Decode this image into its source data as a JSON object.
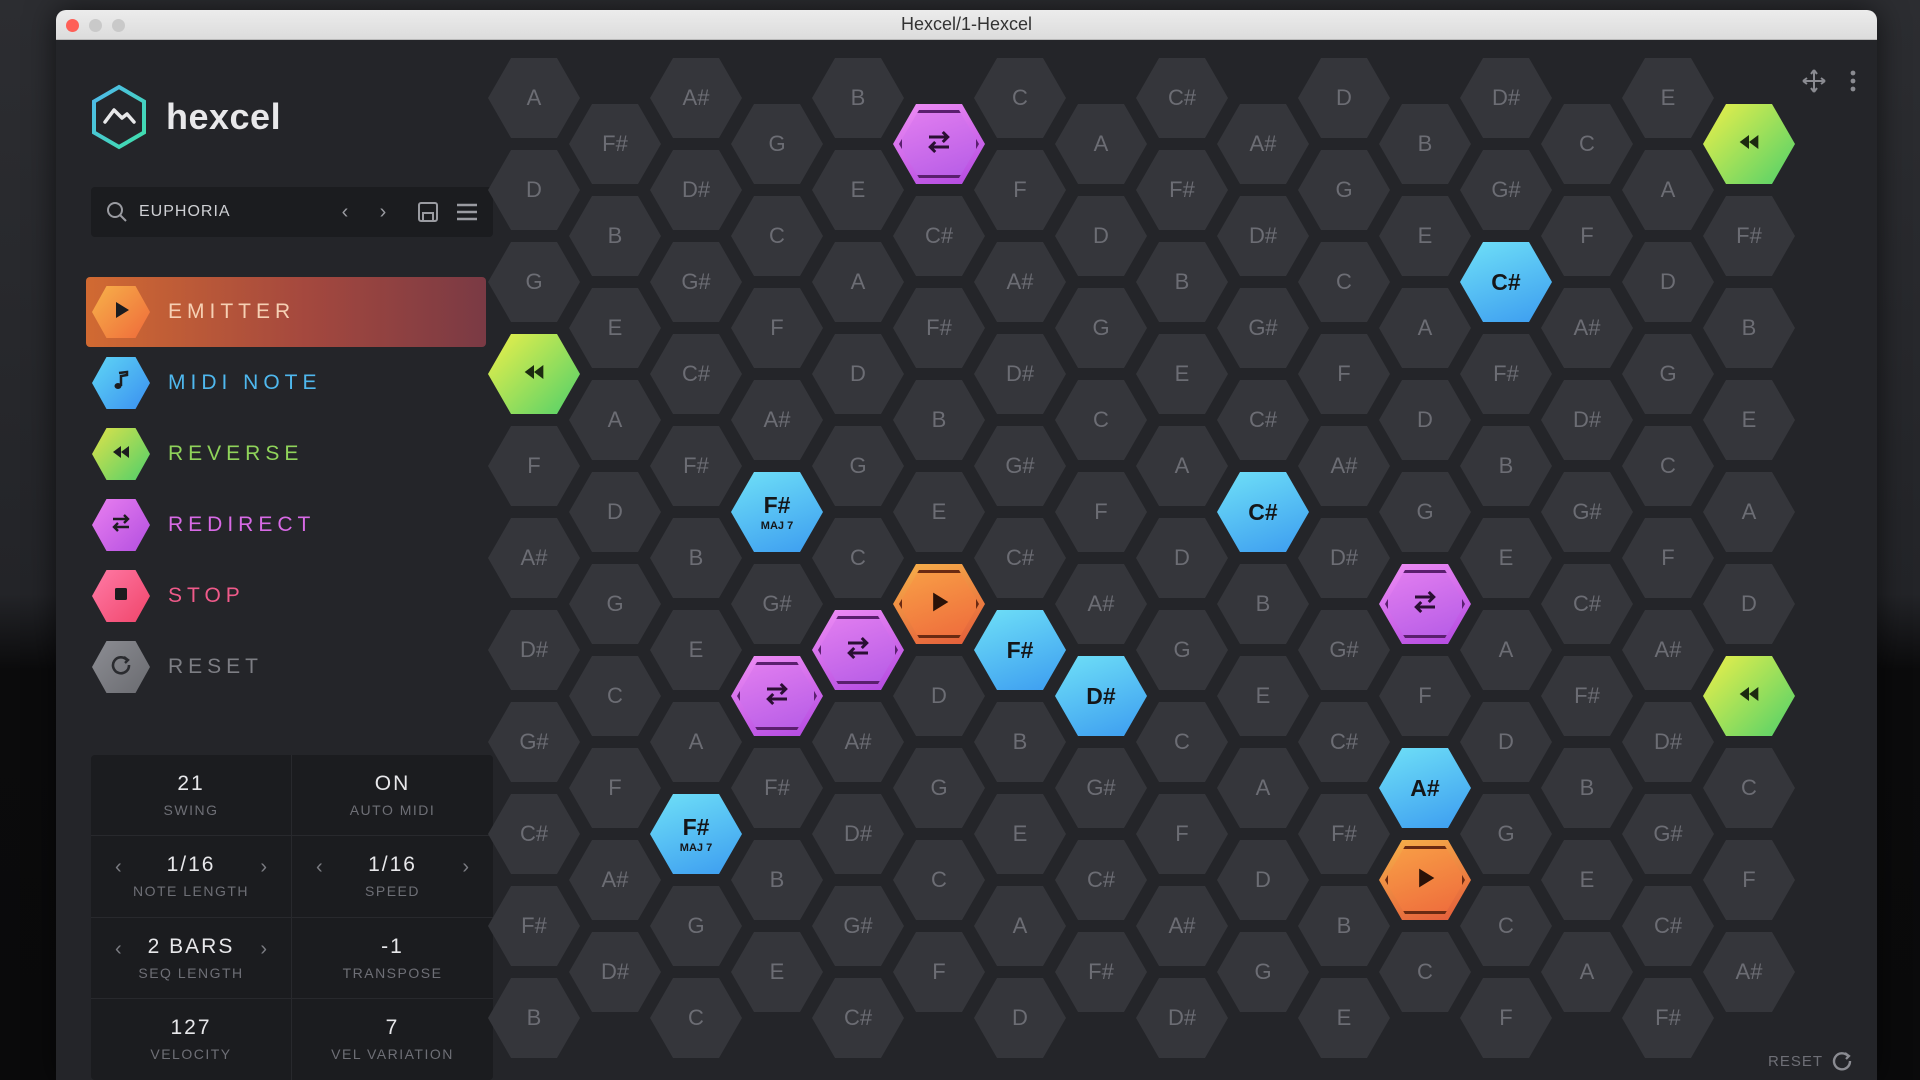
{
  "window": {
    "title": "Hexcel/1-Hexcel"
  },
  "brand": {
    "name": "hexcel",
    "logo_icon": "hexcel-logo-icon",
    "accent": "#3fd1c4"
  },
  "preset": {
    "name": "EUPHORIA",
    "icons": [
      "search-icon",
      "chevron-left-icon",
      "chevron-right-icon",
      "save-icon",
      "menu-icon"
    ]
  },
  "tools": [
    {
      "id": "emitter",
      "label": "EMITTER",
      "color": "#f08a3a",
      "icon": "play-icon",
      "active": true
    },
    {
      "id": "midi-note",
      "label": "MIDI NOTE",
      "color": "#4fb8ee",
      "icon": "music-note-icon",
      "active": false
    },
    {
      "id": "reverse",
      "label": "REVERSE",
      "color": "#8fd35a",
      "icon": "rewind-icon",
      "active": false
    },
    {
      "id": "redirect",
      "label": "REDIRECT",
      "color": "#d86ae6",
      "icon": "redirect-arrows-icon",
      "active": false
    },
    {
      "id": "stop",
      "label": "STOP",
      "color": "#f05a8a",
      "icon": "stop-icon",
      "active": false
    },
    {
      "id": "reset",
      "label": "RESET",
      "color": "#7d7e84",
      "icon": "reset-icon",
      "active": false
    }
  ],
  "params": [
    {
      "id": "swing",
      "value": "21",
      "label": "SWING",
      "arrows": false
    },
    {
      "id": "auto-midi",
      "value": "ON",
      "label": "AUTO MIDI",
      "arrows": false
    },
    {
      "id": "note-length",
      "value": "1/16",
      "label": "NOTE LENGTH",
      "arrows": true
    },
    {
      "id": "speed",
      "value": "1/16",
      "label": "SPEED",
      "arrows": true
    },
    {
      "id": "seq-length",
      "value": "2 BARS",
      "label": "SEQ LENGTH",
      "arrows": true
    },
    {
      "id": "transpose",
      "value": "-1",
      "label": "TRANSPOSE",
      "arrows": false
    },
    {
      "id": "velocity",
      "value": "127",
      "label": "VELOCITY",
      "arrows": false
    },
    {
      "id": "vel-variation",
      "value": "7",
      "label": "VEL VARIATION",
      "arrows": false
    }
  ],
  "grid": {
    "columns": [
      [
        "A",
        "D",
        "G",
        "REV",
        "F",
        "A#",
        "D#",
        "G#",
        "C#",
        "F#",
        "B"
      ],
      [
        "F#",
        "B",
        "E",
        "A",
        "D",
        "G",
        "C",
        "F",
        "A#",
        "D#"
      ],
      [
        "A#",
        "D#",
        "G#",
        "C#",
        "F#",
        "B",
        "E",
        "A",
        "D",
        "G",
        "C"
      ],
      [
        "G",
        "C",
        "F",
        "A#",
        "D#",
        "G#",
        "RED",
        "F#",
        "B",
        "E"
      ],
      [
        "B",
        "E",
        "A",
        "D",
        "G",
        "C",
        "RED",
        "A#",
        "D#",
        "G#",
        "C#"
      ],
      [
        "RED",
        "C#",
        "F#",
        "B",
        "E",
        "EMIT",
        "D",
        "G",
        "C",
        "F"
      ],
      [
        "C",
        "F",
        "A#",
        "D#",
        "G#",
        "C#",
        "F#",
        "B",
        "E",
        "A",
        "D"
      ],
      [
        "A",
        "D",
        "G",
        "C",
        "F",
        "A#",
        "D#",
        "G#",
        "C#",
        "F#"
      ],
      [
        "C#",
        "F#",
        "B",
        "E",
        "A",
        "D",
        "G",
        "C",
        "F",
        "A#",
        "D#"
      ],
      [
        "A#",
        "D#",
        "G#",
        "C#",
        "F#",
        "B",
        "E",
        "A",
        "D",
        "G"
      ],
      [
        "D",
        "G",
        "C",
        "F",
        "A#",
        "D#",
        "G#",
        "C#",
        "F#",
        "B",
        "E"
      ],
      [
        "B",
        "E",
        "A",
        "D",
        "G",
        "RED",
        "F",
        "A#",
        "EMIT",
        "C"
      ],
      [
        "D#",
        "G#",
        "C#",
        "F#",
        "B",
        "E",
        "A",
        "D",
        "G",
        "C",
        "F"
      ],
      [
        "C",
        "F",
        "A#",
        "D#",
        "G#",
        "C#",
        "F#",
        "B",
        "E",
        "A"
      ],
      [
        "E",
        "A",
        "D",
        "G",
        "C",
        "F",
        "A#",
        "D#",
        "G#",
        "C#",
        "F#"
      ],
      [
        "REV",
        "F#",
        "B",
        "E",
        "A",
        "D",
        "REV",
        "C",
        "F",
        "A#"
      ]
    ],
    "note_overrides": [
      {
        "col": 2,
        "row": 8,
        "note": "F#",
        "sub": "MAJ 7"
      },
      {
        "col": 9,
        "row": 5,
        "note": "C#"
      },
      {
        "col": 12,
        "row": 4,
        "note": "C#"
      }
    ],
    "midi_notes": [
      {
        "col": 2,
        "row": 8,
        "label": "F#",
        "sub": "MAJ 7"
      },
      {
        "col": 3,
        "row": 4,
        "label": "F#",
        "sub": "MAJ 7"
      },
      {
        "col": 6,
        "row": 6,
        "label": "F#"
      },
      {
        "col": 7,
        "row": 6,
        "label": "D#"
      },
      {
        "col": 9,
        "row": 4,
        "label": "C#"
      },
      {
        "col": 11,
        "row": 7,
        "label": "A#"
      },
      {
        "col": 12,
        "row": 2,
        "label": "C#"
      }
    ],
    "colors": {
      "cell": "#35363b",
      "note_text": "#6c6d74",
      "midi": "#4fb8ee",
      "redirect": "#d86ae6",
      "reverse": "#a8dc4a",
      "emitter": "#f08a3a"
    }
  },
  "footer": {
    "reset_label": "RESET"
  }
}
